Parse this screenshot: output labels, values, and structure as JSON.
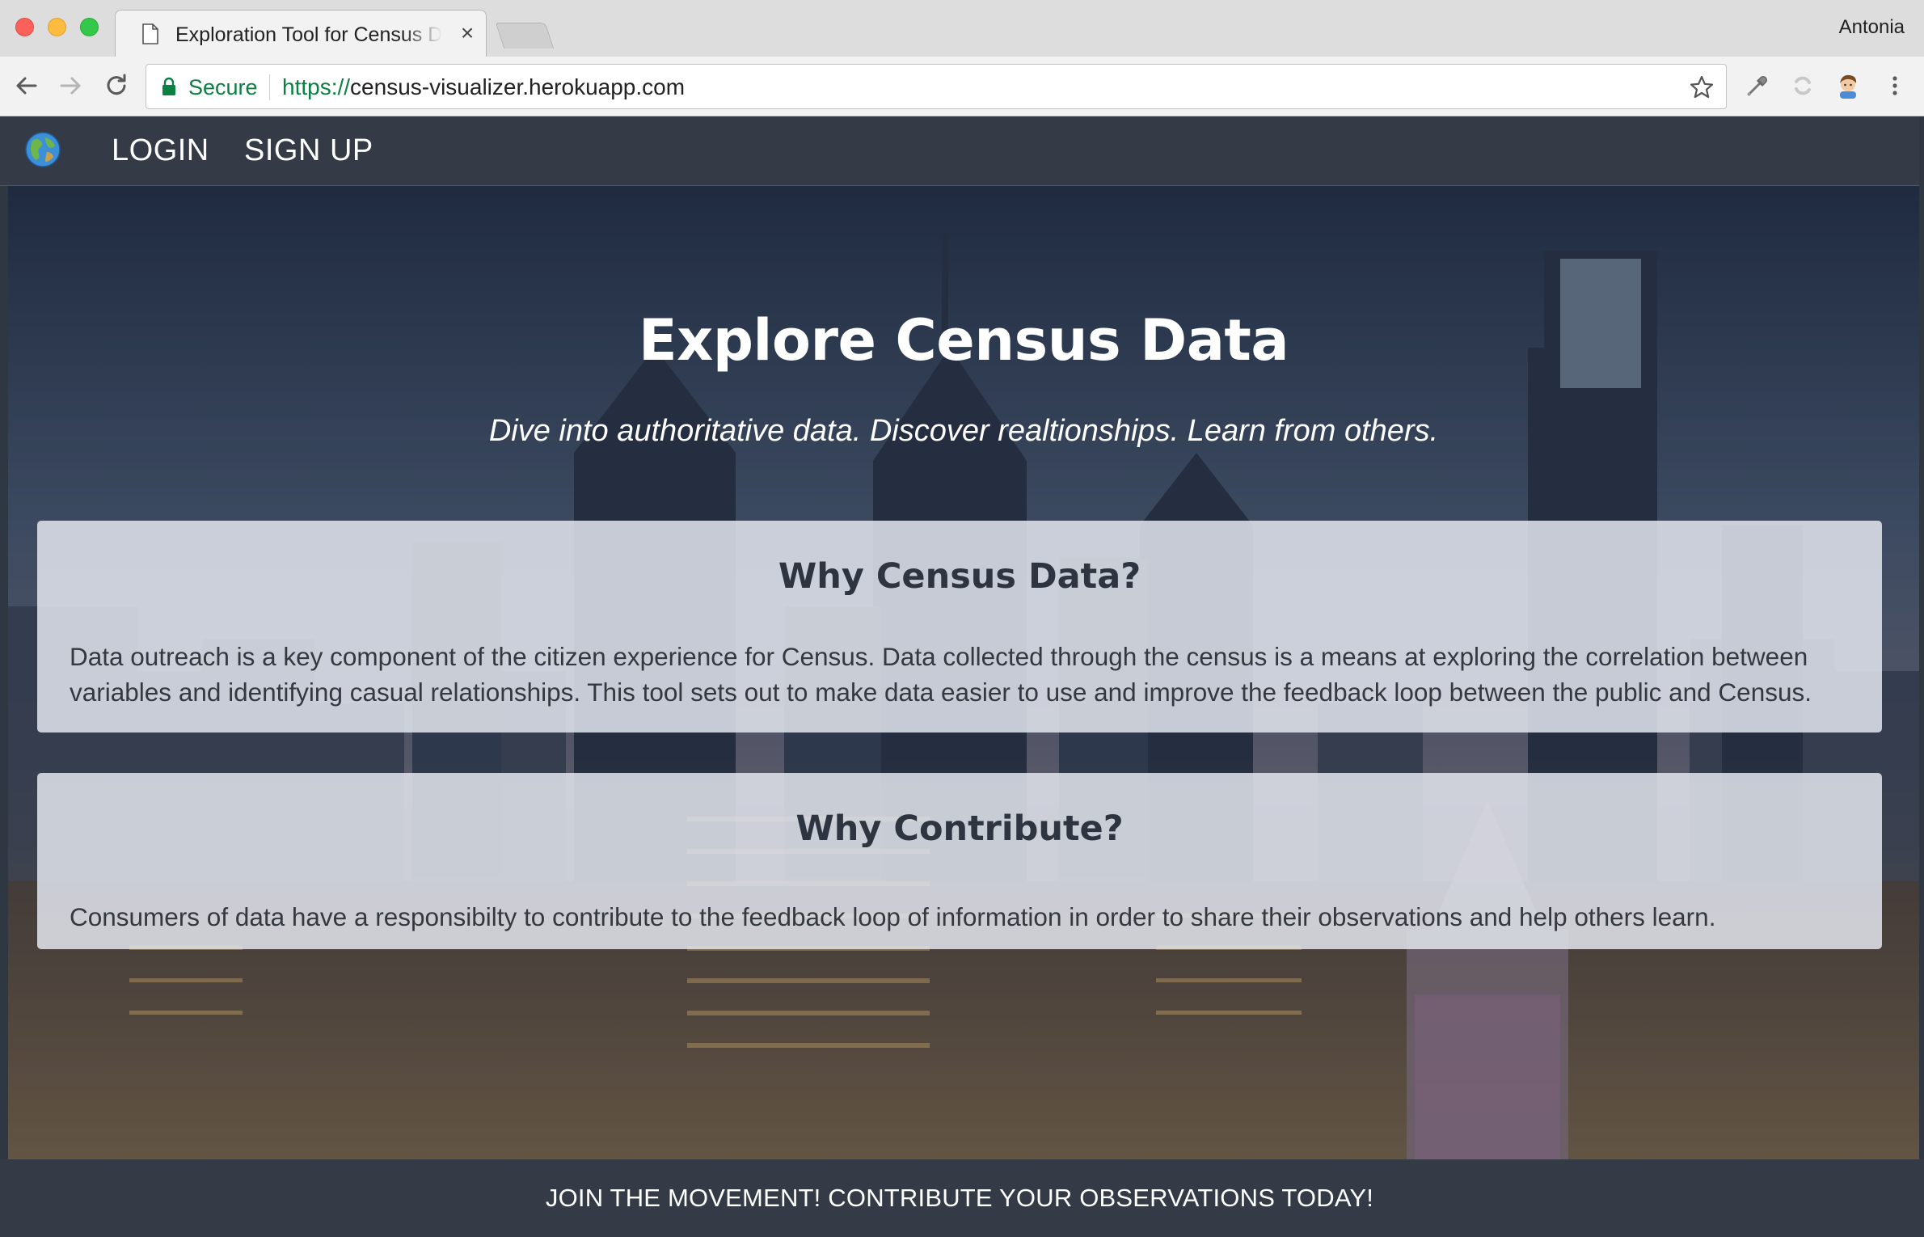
{
  "browser": {
    "tab_title": "Exploration Tool for Census Data",
    "tab_close": "×",
    "profile_name": "Antonia",
    "secure_label": "Secure",
    "url_scheme": "https://",
    "url_host": "census-visualizer.herokuapp.com"
  },
  "nav": {
    "logo_icon": "globe-icon",
    "login": "LOGIN",
    "signup": "SIGN UP"
  },
  "hero": {
    "title": "Explore Census Data",
    "subtitle": "Dive into authoritative data. Discover realtionships. Learn from others."
  },
  "panels": [
    {
      "title": "Why Census Data?",
      "body": "Data outreach is a key component of the citizen experience for Census. Data collected through the census is a means at exploring the correlation between variables and identifying casual relationships. This tool sets out to make data easier to use and improve the feedback loop between the public and Census."
    },
    {
      "title": "Why Contribute?",
      "body": "Consumers of data have a responsibilty to contribute to the feedback loop of information in order to share their observations and help others learn."
    }
  ],
  "footer": {
    "cta": "JOIN THE MOVEMENT! CONTRIBUTE YOUR OBSERVATIONS TODAY!"
  },
  "colors": {
    "nav_bg": "#343b47",
    "secure_green": "#0b8043",
    "panel_bg": "#e2e5ed"
  }
}
